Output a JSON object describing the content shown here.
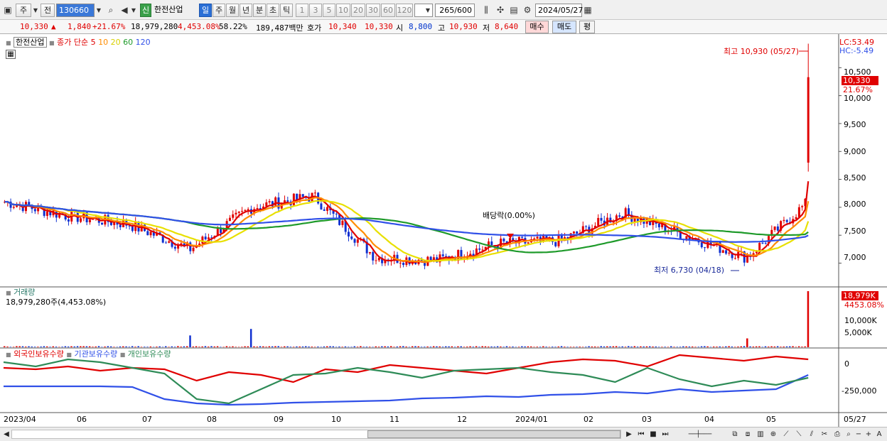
{
  "toolbar": {
    "market_type": "주",
    "prev_label": "전",
    "stock_code": "130660",
    "stock_badge": "신",
    "stock_name": "한전산업",
    "periods": [
      "일",
      "주",
      "월",
      "년",
      "분",
      "초",
      "틱"
    ],
    "active_period": "일",
    "intervals": [
      "1",
      "3",
      "5",
      "10",
      "20",
      "30",
      "60",
      "120"
    ],
    "count_value": "265",
    "count_total": "/600",
    "date_value": "2024/05/27"
  },
  "quote": {
    "price": "10,330",
    "change_arrow": "▲",
    "change": "1,840",
    "change_pct": "+21.67%",
    "volume": "18,979,280",
    "volume_pct": "4,453.08%",
    "turnover_pct": "58.22%",
    "amount": "189,487백만",
    "hoga_label": "호가",
    "ask": "10,340",
    "bid": "10,330",
    "open_label": "시",
    "open": "8,800",
    "high_label": "고",
    "high": "10,930",
    "low_label": "저",
    "low": "8,640",
    "buy_label": "매수",
    "sell_label": "매도",
    "eval_label": "평"
  },
  "price_panel": {
    "stock_tag": "한전산업",
    "close_label": "종가 단순",
    "ma_labels": [
      "5",
      "10",
      "20",
      "60",
      "120"
    ],
    "ma_colors": [
      "#e00000",
      "#ff8c00",
      "#e8e000",
      "#1e9a2a",
      "#3050e8"
    ],
    "lc_label": "LC:53.49",
    "hc_label": "HC:-5.49",
    "current_tag": "10,330",
    "current_pct": "21.67%",
    "high_annotation": "최고 10,930 (05/27)",
    "low_annotation": "최저 6,730 (04/18)",
    "dividend_annotation": "배당락(0.00%)",
    "y_ticks": [
      "10,500",
      "10,000",
      "9,500",
      "9,000",
      "8,500",
      "8,000",
      "7,500",
      "7,000"
    ]
  },
  "volume_panel": {
    "title": "거래량",
    "value_line": "18,979,280주(4,453.08%)",
    "current_tag": "18,979K",
    "current_pct": "4453.08%",
    "y_ticks": [
      "10,000K",
      "5,000K"
    ]
  },
  "holding_panel": {
    "series": [
      "외국인보유수량",
      "기관보유수량",
      "개인보유수량"
    ],
    "series_colors": [
      "#e00000",
      "#3050e8",
      "#2e8b57"
    ],
    "y_ticks": [
      "0",
      "-250,000"
    ]
  },
  "x_axis": {
    "ticks": [
      "2023/04",
      "06",
      "07",
      "08",
      "09",
      "10",
      "11",
      "12",
      "2024/01",
      "02",
      "03",
      "04",
      "05"
    ],
    "end_label": "05/27"
  },
  "chart_data": {
    "type": "candlestick",
    "title": "한전산업",
    "period": "daily",
    "range": [
      "2023/04",
      "2024/05/27"
    ],
    "ylim": [
      6600,
      11000
    ],
    "monthly_close_approx": [
      {
        "x": "2023/04",
        "close": 8100
      },
      {
        "x": "2023/05",
        "close": 7850
      },
      {
        "x": "2023/06",
        "close": 7700
      },
      {
        "x": "2023/07",
        "close": 7250
      },
      {
        "x": "2023/08",
        "close": 8000
      },
      {
        "x": "2023/09",
        "close": 8200
      },
      {
        "x": "2023/10",
        "close": 7100
      },
      {
        "x": "2023/11",
        "close": 7050
      },
      {
        "x": "2023/12",
        "close": 7350
      },
      {
        "x": "2024/01",
        "close": 7400
      },
      {
        "x": "2024/02",
        "close": 7900
      },
      {
        "x": "2024/03",
        "close": 7500
      },
      {
        "x": "2024/04",
        "close": 7100
      },
      {
        "x": "2024/05",
        "close": 8100
      },
      {
        "x": "2024/05/27",
        "close": 10330
      }
    ],
    "high": {
      "date": "05/27",
      "value": 10930
    },
    "low": {
      "date": "04/18",
      "value": 6730
    },
    "last": {
      "open": 8800,
      "high": 10930,
      "low": 8640,
      "close": 10330
    },
    "volume_spikes_k": [
      {
        "x": "2023/07",
        "value": 4000
      },
      {
        "x": "2023/08",
        "value": 6200
      },
      {
        "x": "2024/04",
        "value": 3000
      },
      {
        "x": "2024/05/27",
        "value": 18979
      }
    ]
  }
}
